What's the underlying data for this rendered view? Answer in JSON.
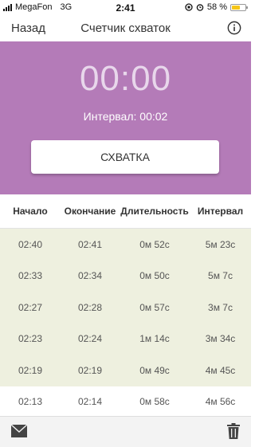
{
  "status_bar": {
    "carrier": "MegaFon",
    "network": "3G",
    "time": "2:41",
    "battery": "58 %"
  },
  "nav": {
    "back_label": "Назад",
    "title": "Счетчик схваток"
  },
  "timer": {
    "value": "00:00",
    "interval_label": "Интервал: 00:02",
    "button_label": "СХВАТКА"
  },
  "table": {
    "headers": [
      "Начало",
      "Окончание",
      "Длительность",
      "Интервал"
    ],
    "rows": [
      {
        "start": "02:40",
        "end": "02:41",
        "duration": "0м 52с",
        "interval": "5м 23с"
      },
      {
        "start": "02:33",
        "end": "02:34",
        "duration": "0м 50с",
        "interval": "5м 7с"
      },
      {
        "start": "02:27",
        "end": "02:28",
        "duration": "0м 57с",
        "interval": "3м 7с"
      },
      {
        "start": "02:23",
        "end": "02:24",
        "duration": "1м 14с",
        "interval": "3м 34с"
      },
      {
        "start": "02:19",
        "end": "02:19",
        "duration": "0м 49с",
        "interval": "4м 45с"
      },
      {
        "start": "02:13",
        "end": "02:14",
        "duration": "0м 58с",
        "interval": "4м 56с"
      }
    ]
  },
  "toolbar": {
    "left_icon": "mail-icon",
    "right_icon": "trash-icon"
  },
  "colors": {
    "hero": "#b47bb8",
    "timer_text": "#e8d7eb",
    "row_highlight": "#eef0df",
    "battery": "#f5c518"
  }
}
